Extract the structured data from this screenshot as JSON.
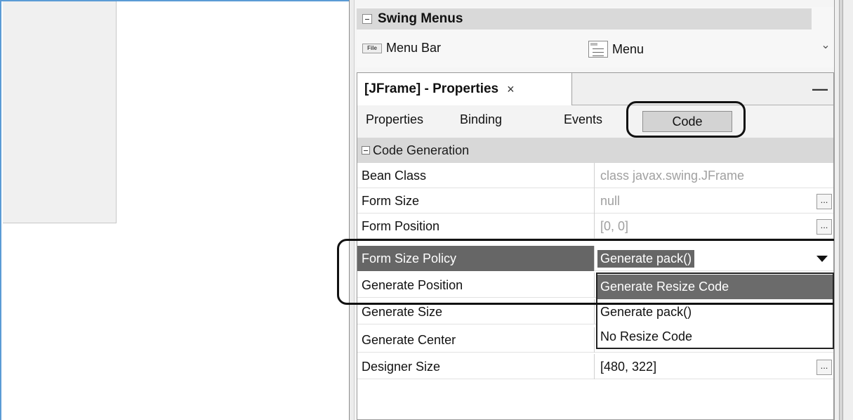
{
  "palette": {
    "section_title": "Swing Menus",
    "items": [
      {
        "label": "Menu Bar",
        "icon_text": "File"
      },
      {
        "label": "Menu"
      }
    ]
  },
  "properties_window": {
    "tab_title": "[JFrame] - Properties",
    "close_glyph": "×",
    "minimize_glyph": "—",
    "subtabs": [
      "Properties",
      "Binding",
      "Events",
      "Code"
    ],
    "active_subtab": "Code",
    "section": "Code Generation",
    "rows": [
      {
        "name": "Bean Class",
        "value": "class javax.swing.JFrame"
      },
      {
        "name": "Form Size",
        "value": "null"
      },
      {
        "name": "Form Position",
        "value": "[0, 0]"
      },
      {
        "name": "Form Size Policy",
        "value": "Generate pack()"
      },
      {
        "name": "Generate Position",
        "value": ""
      },
      {
        "name": "Generate Size",
        "value": ""
      },
      {
        "name": "Generate Center",
        "value": ""
      },
      {
        "name": "Designer Size",
        "value": "[480, 322]"
      }
    ],
    "dropdown_options": [
      "Generate Resize Code",
      "Generate pack()",
      "No Resize Code"
    ],
    "hovered_option": "Generate Resize Code"
  },
  "ellipsis_label": "...",
  "colors": {
    "selection": "#666666",
    "section_bg": "#d8d8d8",
    "active_tab": "#d3d3d3",
    "frame_edge": "#5b9bd5"
  }
}
